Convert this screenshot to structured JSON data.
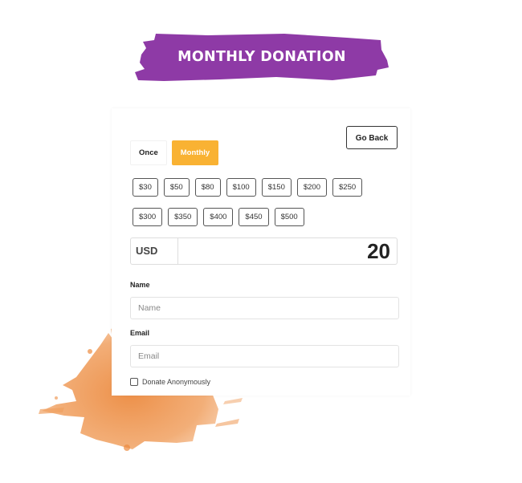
{
  "banner": {
    "title": "MONTHLY DONATION",
    "color": "#8e3aa6"
  },
  "splash": {
    "color": "#ef9a57"
  },
  "form": {
    "go_back_label": "Go Back",
    "frequency": [
      {
        "label": "Once",
        "active": false
      },
      {
        "label": "Monthly",
        "active": true
      }
    ],
    "accent_color": "#f9b233",
    "amounts_row1": [
      "$30",
      "$50",
      "$80",
      "$100",
      "$150",
      "$200",
      "$250"
    ],
    "amounts_row2": [
      "$300",
      "$350",
      "$400",
      "$450",
      "$500"
    ],
    "currency": "USD",
    "amount": "20",
    "name_label": "Name",
    "name_placeholder": "Name",
    "email_label": "Email",
    "email_placeholder": "Email",
    "anonymous_label": "Donate Anonymously",
    "anonymous_checked": false
  }
}
